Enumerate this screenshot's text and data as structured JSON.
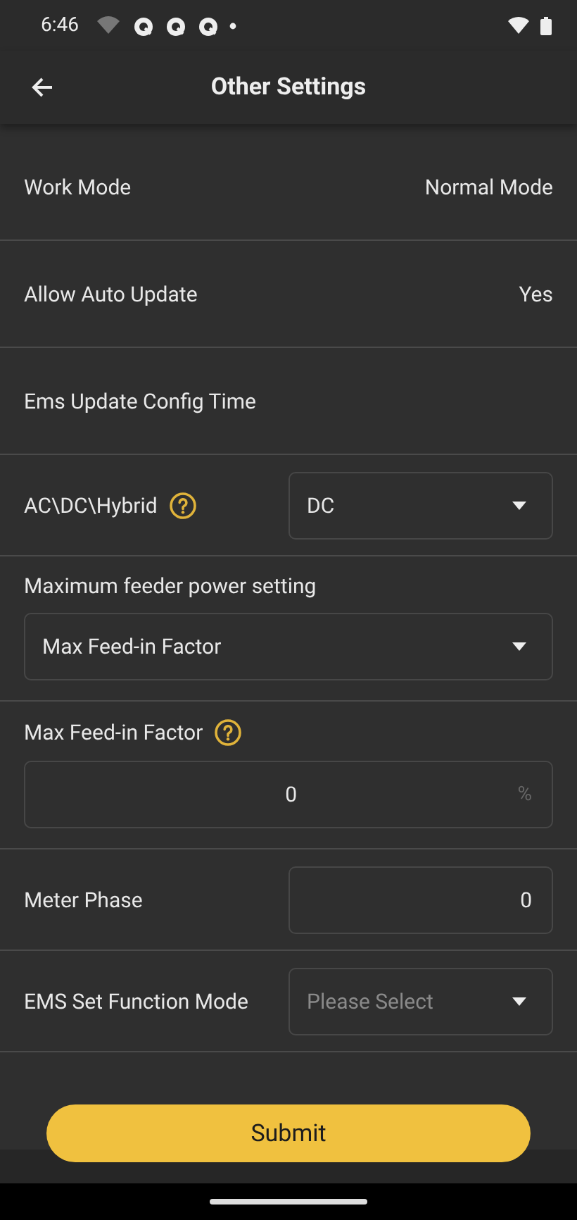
{
  "status_bar": {
    "time": "6:46"
  },
  "app_bar": {
    "title": "Other Settings"
  },
  "settings": [
    {
      "kind": "value",
      "label": "Work Mode",
      "help": false,
      "value": "Normal Mode"
    },
    {
      "kind": "value",
      "label": "Allow Auto Update",
      "help": false,
      "value": "Yes"
    },
    {
      "kind": "value",
      "label": "Ems Update Config Time",
      "help": false
    },
    {
      "kind": "select-inline",
      "label": "AC\\DC\\Hybrid",
      "help": true,
      "value": "DC"
    },
    {
      "kind": "select-below",
      "label": "Maximum feeder power setting",
      "help": false,
      "value": "Max Feed-in Factor"
    },
    {
      "kind": "input-below",
      "label": "Max Feed-in Factor",
      "help": true,
      "value": "0",
      "suffix": "%"
    },
    {
      "kind": "input-inline",
      "label": "Meter Phase",
      "help": false,
      "value": "0"
    },
    {
      "kind": "select-inline",
      "label": "EMS Set Function Mode",
      "help": false,
      "placeholder": "Please Select"
    }
  ],
  "submit": "Submit"
}
